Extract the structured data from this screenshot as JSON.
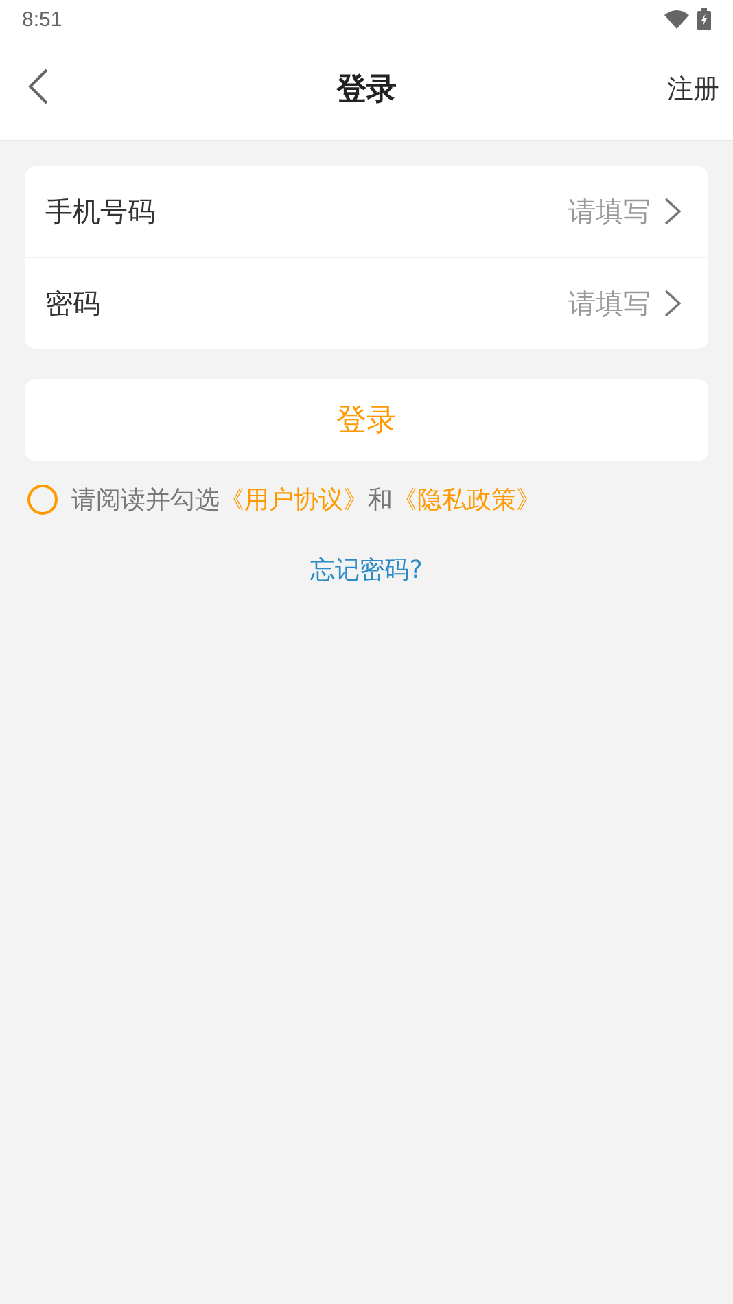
{
  "status_bar": {
    "time": "8:51"
  },
  "nav": {
    "title": "登录",
    "action": "注册"
  },
  "fields": [
    {
      "label": "手机号码",
      "placeholder": "请填写"
    },
    {
      "label": "密码",
      "placeholder": "请填写"
    }
  ],
  "login_button": "登录",
  "agreement": {
    "checked": false,
    "parts": [
      {
        "kind": "text",
        "text": "请阅读并勾选"
      },
      {
        "kind": "link",
        "text": "《用户协议》"
      },
      {
        "kind": "text",
        "text": "和"
      },
      {
        "kind": "link",
        "text": "《隐私政策》"
      }
    ]
  },
  "forgot_link": "忘记密码?"
}
